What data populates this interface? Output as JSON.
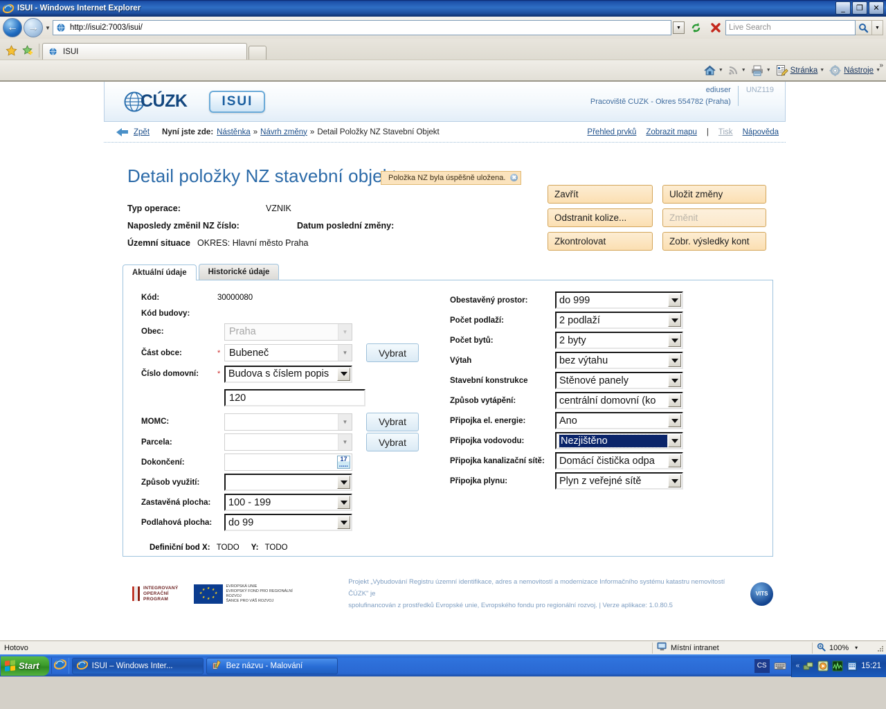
{
  "window": {
    "title": "ISUI - Windows Internet Explorer",
    "minimize": "_",
    "maximize": "❐",
    "close": "✕"
  },
  "browser": {
    "url": "http://isui2:7003/isui/",
    "search_placeholder": "Live Search",
    "tab_label": "ISUI",
    "commands": [
      {
        "name": "home",
        "label": ""
      },
      {
        "name": "feeds",
        "label": ""
      },
      {
        "name": "print",
        "label": ""
      },
      {
        "name": "page",
        "label": "Stránka"
      },
      {
        "name": "tools",
        "label": "Nástroje"
      }
    ],
    "overflow": "»"
  },
  "app_header": {
    "logo_text": "CÚZK",
    "module": "ISUI",
    "user": "ediuser",
    "workplace": "Pracoviště CUZK - Okres 554782 (Praha)",
    "session_code": "UNZ119"
  },
  "breadcrumb": {
    "back": "Zpět",
    "prefix": "Nyní jste zde:",
    "items": [
      "Nástěnka",
      "Návrh změny",
      "Detail Položky NZ Stavební Objekt"
    ],
    "separator": "»",
    "right_links": [
      "Přehled prvků",
      "Zobrazit mapu",
      "Tisk",
      "Nápověda"
    ],
    "right_divider": "|"
  },
  "flash": {
    "message": "Položka NZ byla úspěšně uložena.",
    "close": "✖"
  },
  "page": {
    "title": "Detail položky NZ stavební objekt",
    "meta": [
      {
        "key": "Typ operace:",
        "value": "VZNIK"
      },
      {
        "key": "Naposledy změnil NZ číslo:",
        "value": "Datum poslední změny:"
      },
      {
        "key": "Územní situace",
        "value": "OKRES: Hlavní město Praha"
      }
    ]
  },
  "actions": [
    {
      "label": "Zavřít",
      "disabled": false
    },
    {
      "label": "Uložit změny",
      "disabled": false
    },
    {
      "label": "Odstranit kolize...",
      "disabled": false
    },
    {
      "label": "Změnit",
      "disabled": true
    },
    {
      "label": "Zkontrolovat",
      "disabled": false
    },
    {
      "label": "Zobr. výsledky kont",
      "disabled": false
    }
  ],
  "tabs": [
    {
      "label": "Aktuální údaje",
      "active": true
    },
    {
      "label": "Historické údaje",
      "active": false
    }
  ],
  "form_left": {
    "kod_label": "Kód:",
    "kod_value": "30000080",
    "kod_budovy_label": "Kód budovy:",
    "kod_budovy_value": "",
    "obec_label": "Obec:",
    "obec_value": "Praha",
    "cast_obce_label": "Část obce:",
    "cast_obce_value": "Bubeneč",
    "cislo_domovni_label": "Číslo domovní:",
    "cislo_domovni_type": "Budova s číslem popis",
    "cislo_domovni_value": "120",
    "momc_label": "MOMC:",
    "momc_value": "",
    "parcela_label": "Parcela:",
    "parcela_value": "",
    "dokonceni_label": "Dokončení:",
    "dokonceni_value": "",
    "zpusob_vyuziti_label": "Způsob využití:",
    "zpusob_vyuziti_value": "",
    "zastavena_plocha_label": "Zastavěná plocha:",
    "zastavena_plocha_value": "100 - 199",
    "podlahova_plocha_label": "Podlahová plocha:",
    "podlahova_plocha_value": "do 99",
    "vybrat_label": "Vybrat",
    "calendar_day": "17",
    "defbod_label": "Definiční bod X:",
    "defbod_x": "TODO",
    "defbod_y_label": "Y:",
    "defbod_y": "TODO"
  },
  "form_right": [
    {
      "label": "Obestavěný prostor:",
      "value": "do 999",
      "focused": false
    },
    {
      "label": "Počet podlaží:",
      "value": "2 podlaží",
      "focused": false
    },
    {
      "label": "Počet bytů:",
      "value": "2 byty",
      "focused": false
    },
    {
      "label": "Výtah",
      "value": "bez výtahu",
      "focused": false
    },
    {
      "label": "Stavební konstrukce",
      "value": "Stěnové panely",
      "focused": false
    },
    {
      "label": "Způsob vytápění:",
      "value": "centrální domovní (ko",
      "focused": false
    },
    {
      "label": "Připojka el. energie:",
      "value": "Ano",
      "focused": false
    },
    {
      "label": "Připojka vodovodu:",
      "value": "Nezjištěno",
      "focused": true
    },
    {
      "label": "Připojka kanalizační sítě:",
      "value": "Domácí čistička odpa",
      "focused": false
    },
    {
      "label": "Připojka plynu:",
      "value": "Plyn z veřejné sítě",
      "focused": false
    }
  ],
  "footer": {
    "iop_line1": "INTEGROVANÝ",
    "iop_line2": "OPERAČNÍ",
    "iop_line3": "PROGRAM",
    "eu_line1": "EVROPSKÁ UNIE",
    "eu_line2": "EVROPSKÝ FOND PRO REGIONÁLNÍ ROZVOJ",
    "eu_line3": "ŠANCE PRO VÁŠ ROZVOJ",
    "project_line1": "Projekt „Vybudování Registru územní identifikace, adres a nemovitostí a modernizace Informačního systému katastru nemovitostí ČÚZK\" je",
    "project_line2": "spolufinancován z prostředků Evropské unie, Evropského fondu pro regionální rozvoj. | Verze aplikace: 1.0.80.5",
    "vits_label": "VITS"
  },
  "statusbar": {
    "status": "Hotovo",
    "zone": "Místní intranet",
    "zoom": "100%",
    "zoom_caret": "▾"
  },
  "taskbar": {
    "start": "Start",
    "buttons": [
      {
        "label": "ISUI – Windows Inter...",
        "active": true
      },
      {
        "label": "Bez názvu - Malování",
        "active": false
      }
    ],
    "lang": "CS",
    "tray_expand": "«",
    "clock": "15:21"
  }
}
